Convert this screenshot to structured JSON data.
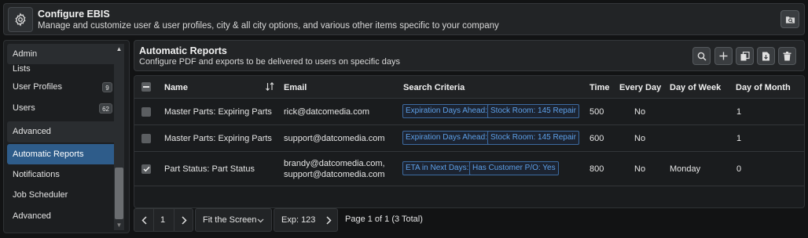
{
  "header": {
    "title": "Configure EBIS",
    "subtitle": "Manage and customize user & user profiles, city & all city options, and various other items specific to your company",
    "icon": "gear-icon",
    "action_icon": "folder-search-icon"
  },
  "sidebar": {
    "items": [
      {
        "label": "Admin",
        "type": "group"
      },
      {
        "label": "Lists"
      },
      {
        "label": "User Profiles",
        "badge": "9"
      },
      {
        "label": "Users",
        "badge": "62"
      },
      {
        "label": "Advanced",
        "type": "group"
      },
      {
        "label": "Automatic Reports",
        "active": true
      },
      {
        "label": "Notifications"
      },
      {
        "label": "Job Scheduler"
      },
      {
        "label": "Advanced"
      }
    ]
  },
  "card": {
    "title": "Automatic Reports",
    "subtitle": "Configure PDF and exports to be delivered to users on specific days",
    "tools": [
      "search-icon",
      "plus-icon",
      "copy-icon",
      "export-file-icon",
      "trash-icon"
    ]
  },
  "table": {
    "columns": {
      "name": "Name",
      "email": "Email",
      "criteria": "Search Criteria",
      "time": "Time",
      "every_day": "Every Day",
      "day_of_week": "Day of Week",
      "day_of_month": "Day of Month"
    },
    "rows": [
      {
        "checked": false,
        "name": "Master Parts: Expiring Parts",
        "email": [
          "rick@datcomedia.com"
        ],
        "criteria": [
          "Expiration Days Ahead:",
          "Stock Room: 145 Repair"
        ],
        "time": "500",
        "every_day": "No",
        "day_of_week": "",
        "day_of_month": "1"
      },
      {
        "checked": false,
        "name": "Master Parts: Expiring Parts",
        "email": [
          "support@datcomedia.com"
        ],
        "criteria": [
          "Expiration Days Ahead:",
          "Stock Room: 145 Repair"
        ],
        "time": "600",
        "every_day": "No",
        "day_of_week": "",
        "day_of_month": "1"
      },
      {
        "checked": true,
        "name": "Part Status: Part Status",
        "email": [
          "brandy@datcomedia.com,",
          "support@datcomedia.com"
        ],
        "criteria": [
          "ETA in Next Days:",
          "Has Customer P/O: Yes"
        ],
        "time": "800",
        "every_day": "No",
        "day_of_week": "Monday",
        "day_of_month": "0"
      }
    ]
  },
  "pager": {
    "page": "1",
    "fit": "Fit the Screen",
    "export": "Exp: 123",
    "summary": "Page 1 of 1 (3 Total)"
  },
  "colors": {
    "accent": "#2e5c8a",
    "chip_text": "#5da0e8",
    "background": "#121314"
  }
}
